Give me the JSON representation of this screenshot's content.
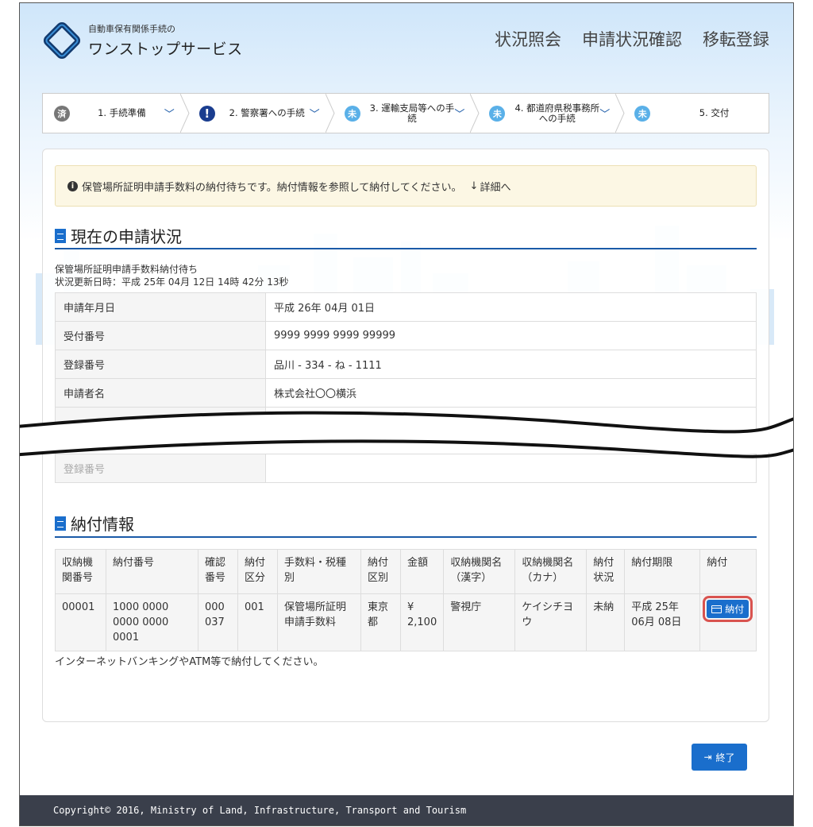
{
  "header": {
    "logo_sub": "自動車保有関係手続の",
    "logo_main": "ワンストップサービス",
    "nav": [
      "状況照会",
      "申請状況確認",
      "移転登録"
    ]
  },
  "steps": [
    {
      "badge": "済",
      "state": "done",
      "label": "1. 手続準備"
    },
    {
      "badge": "!",
      "state": "warn",
      "label": "2. 警察署への手続"
    },
    {
      "badge": "未",
      "state": "todo",
      "label": "3. 運輸支局等への手続"
    },
    {
      "badge": "未",
      "state": "todo",
      "label": "4. 都道府県税事務所への手続"
    },
    {
      "badge": "未",
      "state": "todo",
      "label": "5. 交付"
    }
  ],
  "alert": {
    "message": "保管場所証明申請手数料の納付待ちです。納付情報を参照して納付してください。",
    "link": "詳細へ"
  },
  "current": {
    "title": "現在の申請状況",
    "status": "保管場所証明申請手数料納付待ち",
    "updated": "状況更新日時：平成 25年 04月 12日 14時 42分 13秒",
    "rows": [
      {
        "k": "申請年月日",
        "v": "平成 26年 04月 01日"
      },
      {
        "k": "受付番号",
        "v": "9999 9999 9999 99999"
      },
      {
        "k": "登録番号",
        "v": "品川 - 334 - ね - 1111"
      },
      {
        "k": "申請者名",
        "v": "株式会社〇〇横浜"
      }
    ],
    "faded_row": {
      "k": "登録番号",
      "v": ""
    }
  },
  "payment": {
    "title": "納付情報",
    "headers": [
      "収納機関番号",
      "納付番号",
      "確認番号",
      "納付区分",
      "手数料・税種別",
      "納付区別",
      "金額",
      "収納機関名（漢字）",
      "収納機関名（カナ）",
      "納付状況",
      "納付期限",
      "納付"
    ],
    "row": [
      "00001",
      "1000 0000 0000 0000 0001",
      "000037",
      "001",
      "保管場所証明申請手数料",
      "東京都",
      "¥ 2,100",
      "警視庁",
      "ケイシチヨウ",
      "未納",
      "平成 25年 06月 08日"
    ],
    "pay_button": "納付",
    "note": "インターネットバンキングやATM等で納付してください。"
  },
  "end_button": "終了",
  "footer": "Copyright© 2016, Ministry of Land, Infrastructure, Transport and Tourism"
}
